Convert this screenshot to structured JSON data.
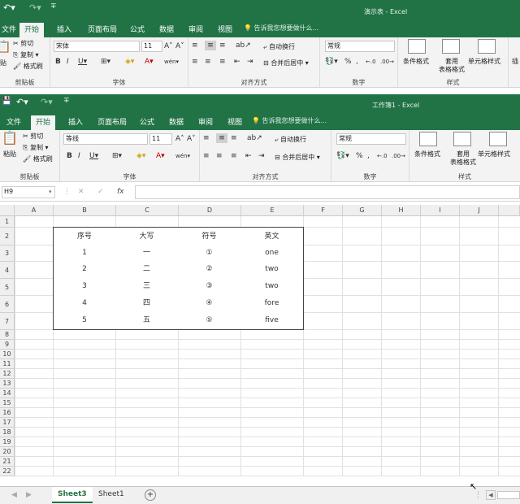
{
  "back_window": {
    "title": "演示表 - Excel",
    "tabs": [
      "文件",
      "开始",
      "插入",
      "页面布局",
      "公式",
      "数据",
      "审阅",
      "视图"
    ],
    "tell_me": "告诉我您想要做什么...",
    "clipboard": {
      "paste": "贴",
      "cut": "剪切",
      "copy": "复制",
      "format_painter": "格式刷",
      "label": "剪贴板"
    },
    "font": {
      "name": "宋体",
      "size": "11",
      "label": "字体"
    },
    "alignment": {
      "wrap": "自动换行",
      "merge": "合并后居中",
      "label": "对齐方式"
    },
    "number": {
      "format": "常规",
      "label": "数字"
    },
    "styles": {
      "conditional": "条件格式",
      "table_line1": "套用",
      "table_line2": "表格格式",
      "cell_styles": "单元格样式",
      "label": "样式"
    },
    "insert": "插"
  },
  "front_window": {
    "title": "工作簿1 - Excel",
    "tabs": [
      "文件",
      "开始",
      "插入",
      "页面布局",
      "公式",
      "数据",
      "审阅",
      "视图"
    ],
    "tell_me": "告诉我您想要做什么...",
    "clipboard": {
      "paste": "粘贴",
      "cut": "剪切",
      "copy": "复制",
      "format_painter": "格式刷",
      "label": "剪贴板"
    },
    "font": {
      "name": "等线",
      "size": "11",
      "label": "字体"
    },
    "alignment": {
      "wrap": "自动换行",
      "merge": "合并后居中",
      "label": "对齐方式"
    },
    "number": {
      "format": "常规",
      "label": "数字"
    },
    "styles": {
      "conditional": "条件格式",
      "table_line1": "套用",
      "table_line2": "表格格式",
      "cell_styles": "单元格样式",
      "label": "样式"
    }
  },
  "formula_bar": {
    "name_box": "H9",
    "fx": "fx",
    "content": ""
  },
  "columns": [
    "A",
    "B",
    "C",
    "D",
    "E",
    "F",
    "G",
    "H",
    "I",
    "J"
  ],
  "rows": [
    "1",
    "2",
    "3",
    "4",
    "5",
    "6",
    "7",
    "8",
    "9",
    "10",
    "11",
    "12",
    "13",
    "14",
    "15",
    "16",
    "17",
    "18",
    "19",
    "20",
    "21",
    "22"
  ],
  "table": {
    "headers": [
      "序号",
      "大写",
      "符号",
      "英文"
    ],
    "rows": [
      [
        "1",
        "一",
        "①",
        "one"
      ],
      [
        "2",
        "二",
        "②",
        "two"
      ],
      [
        "3",
        "三",
        "③",
        "two"
      ],
      [
        "4",
        "四",
        "④",
        "fore"
      ],
      [
        "5",
        "五",
        "⑤",
        "five"
      ]
    ]
  },
  "sheets": [
    "Sheet3",
    "Sheet1"
  ],
  "colors": {
    "excel_green": "#217346"
  }
}
